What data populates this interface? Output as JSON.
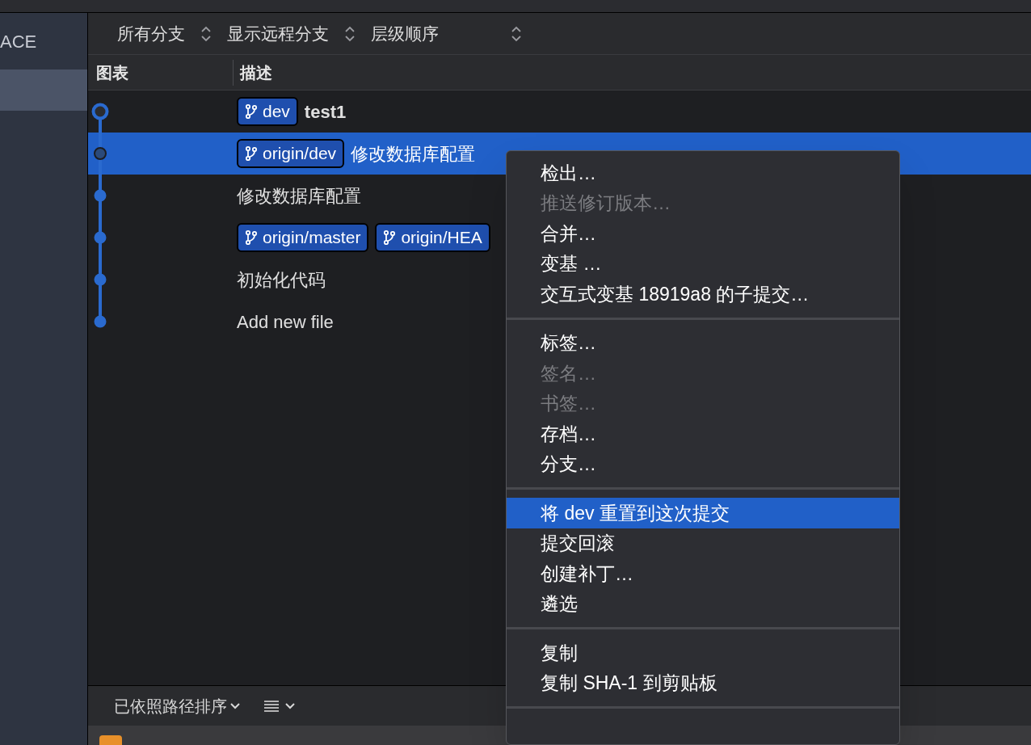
{
  "sidebar": {
    "title": "ACE",
    "items": [
      {
        "selected": true
      }
    ]
  },
  "filters": [
    {
      "label": "所有分支"
    },
    {
      "label": "显示远程分支"
    },
    {
      "label": "层级顺序"
    }
  ],
  "columns": [
    "图表",
    "描述"
  ],
  "commits": [
    {
      "kind": "head",
      "selected": false,
      "bold": true,
      "refs": [
        "dev"
      ],
      "message": "test1"
    },
    {
      "kind": "commit",
      "selected": true,
      "bold": false,
      "refs": [
        "origin/dev"
      ],
      "message": "修改数据库配置"
    },
    {
      "kind": "commit",
      "selected": false,
      "bold": false,
      "message": "修改数据库配置"
    },
    {
      "kind": "commit",
      "selected": false,
      "refs": [
        "origin/master",
        "origin/HEA"
      ]
    },
    {
      "kind": "commit",
      "selected": false,
      "bold": false,
      "message": "初始化代码"
    },
    {
      "kind": "commit",
      "selected": false,
      "bold": false,
      "message": "Add new file"
    }
  ],
  "context_menu": [
    {
      "kind": "item",
      "label": "检出…",
      "disabled": false,
      "selected": false
    },
    {
      "kind": "item",
      "label": "推送修订版本…",
      "disabled": true,
      "selected": false
    },
    {
      "kind": "item",
      "label": "合并…",
      "disabled": false,
      "selected": false
    },
    {
      "kind": "item",
      "label": "变基 …",
      "disabled": false,
      "selected": false
    },
    {
      "kind": "item",
      "label": "交互式变基 18919a8 的子提交…",
      "disabled": false,
      "selected": false
    },
    {
      "kind": "separator"
    },
    {
      "kind": "item",
      "label": "标签…",
      "disabled": false,
      "selected": false
    },
    {
      "kind": "item",
      "label": "签名…",
      "disabled": true,
      "selected": false
    },
    {
      "kind": "item",
      "label": "书签…",
      "disabled": true,
      "selected": false
    },
    {
      "kind": "item",
      "label": "存档…",
      "disabled": false,
      "selected": false
    },
    {
      "kind": "item",
      "label": "分支…",
      "disabled": false,
      "selected": false
    },
    {
      "kind": "separator"
    },
    {
      "kind": "item",
      "label": "将 dev 重置到这次提交",
      "disabled": false,
      "selected": true
    },
    {
      "kind": "item",
      "label": "提交回滚",
      "disabled": false,
      "selected": false
    },
    {
      "kind": "item",
      "label": "创建补丁…",
      "disabled": false,
      "selected": false
    },
    {
      "kind": "item",
      "label": "遴选",
      "disabled": false,
      "selected": false
    },
    {
      "kind": "separator"
    },
    {
      "kind": "item",
      "label": "复制",
      "disabled": false,
      "selected": false
    },
    {
      "kind": "item",
      "label": "复制 SHA-1 到剪贴板",
      "disabled": false,
      "selected": false
    },
    {
      "kind": "separator"
    }
  ],
  "bottom_bar": {
    "sort_label": "已依照路径排序"
  }
}
